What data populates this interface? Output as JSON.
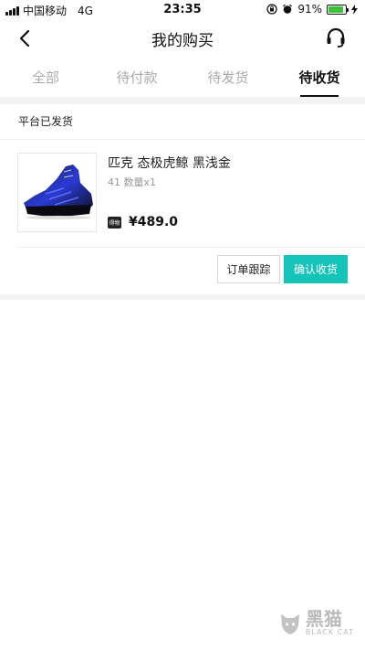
{
  "status_bar": {
    "carrier": "中国移动",
    "network": "4G",
    "time": "23:35",
    "battery": "91%",
    "battery_level": 0.91,
    "battery_color": "#3ac13a"
  },
  "header": {
    "title": "我的购买",
    "back_icon": "chevron-left-icon",
    "service_icon": "headset-icon"
  },
  "tabs": [
    {
      "label": "全部",
      "active": false
    },
    {
      "label": "待付款",
      "active": false
    },
    {
      "label": "待发货",
      "active": false
    },
    {
      "label": "待收货",
      "active": true
    }
  ],
  "order": {
    "status": "平台已发货",
    "product_name": "匹克 态极虎鲸 黑浅金",
    "spec": "41 数量x1",
    "badge": "得物",
    "price": "¥489.0",
    "buttons": {
      "track": "订单跟踪",
      "confirm": "确认收货"
    }
  },
  "colors": {
    "accent": "#16c3b8",
    "divider": "#f4f4f6"
  },
  "watermark": {
    "main": "黑猫",
    "sub": "BLACK CAT"
  }
}
